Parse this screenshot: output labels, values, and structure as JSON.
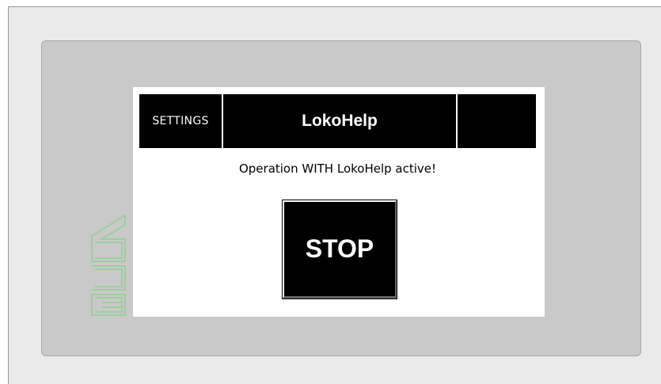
{
  "header": {
    "settings_label": "SETTINGS",
    "title": "LokoHelp",
    "right_label": ""
  },
  "main": {
    "message": "Operation WITH LokoHelp active!",
    "stop_label": "STOP"
  },
  "logo": {
    "icon": "manufacturer-logo-icon",
    "color": "#9ccf9c"
  }
}
